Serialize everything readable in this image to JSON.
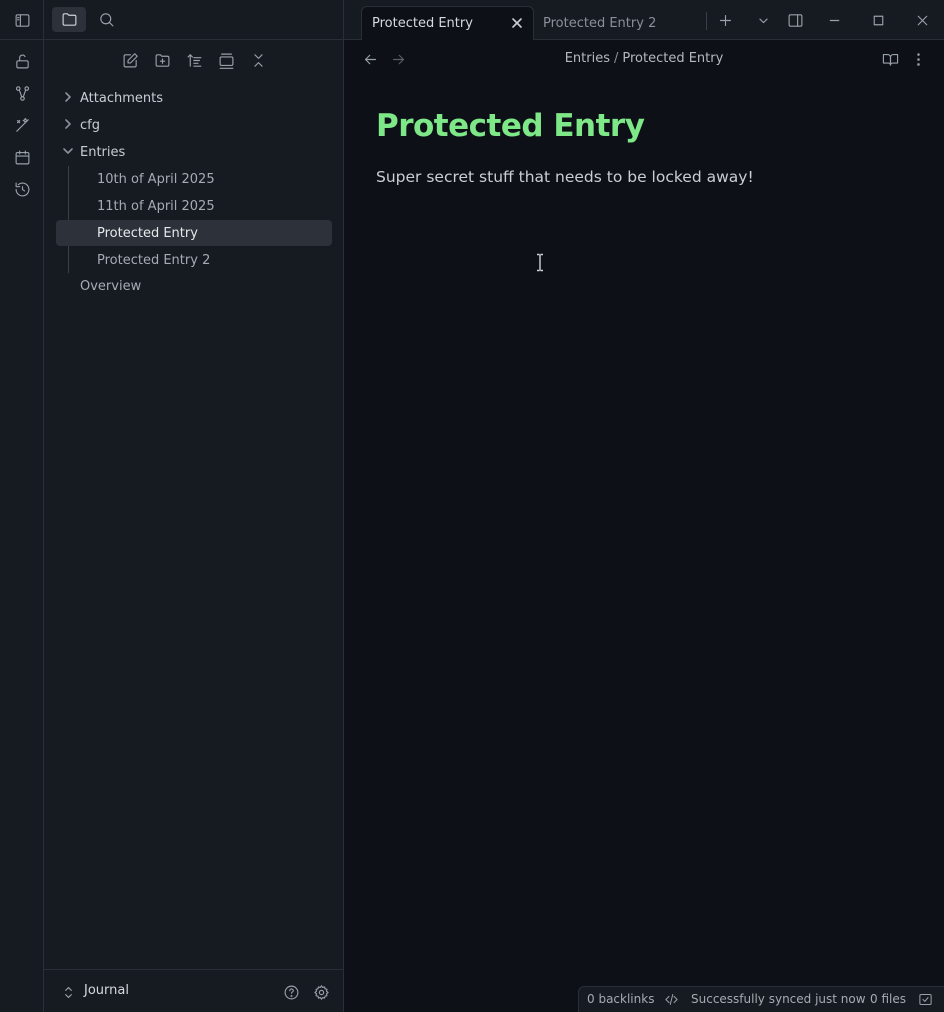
{
  "sidebar": {
    "tree": [
      {
        "label": "Attachments",
        "type": "folder",
        "expanded": false
      },
      {
        "label": "cfg",
        "type": "folder",
        "expanded": false
      },
      {
        "label": "Entries",
        "type": "folder",
        "expanded": true
      },
      {
        "label": "10th of April 2025",
        "type": "file"
      },
      {
        "label": "11th of April 2025",
        "type": "file"
      },
      {
        "label": "Protected Entry",
        "type": "file",
        "selected": true
      },
      {
        "label": "Protected Entry 2",
        "type": "file"
      },
      {
        "label": "Overview",
        "type": "file"
      }
    ],
    "vault_name": "Journal"
  },
  "tabs": [
    {
      "label": "Protected Entry",
      "active": true
    },
    {
      "label": "Protected Entry 2",
      "active": false
    }
  ],
  "breadcrumb": {
    "folder": "Entries",
    "separator": "/",
    "note": "Protected Entry"
  },
  "note": {
    "title": "Protected Entry",
    "body": "Super secret stuff that needs to be locked away!"
  },
  "status": {
    "backlinks": "0 backlinks",
    "sync": "Successfully synced just now",
    "files": "0 files"
  },
  "colors": {
    "background": "#0d1117",
    "panel": "#161b22",
    "heading": "#7ee787",
    "selection": "#2c313a"
  },
  "icons": {
    "ribbon": [
      "sidebar-toggle-icon",
      "unlock-icon",
      "graph-icon",
      "wand-icon",
      "calendar-icon",
      "history-icon"
    ],
    "nav_actions": [
      "new-note-icon",
      "new-folder-icon",
      "sort-icon",
      "auto-reveal-icon",
      "collapse-all-icon"
    ]
  }
}
